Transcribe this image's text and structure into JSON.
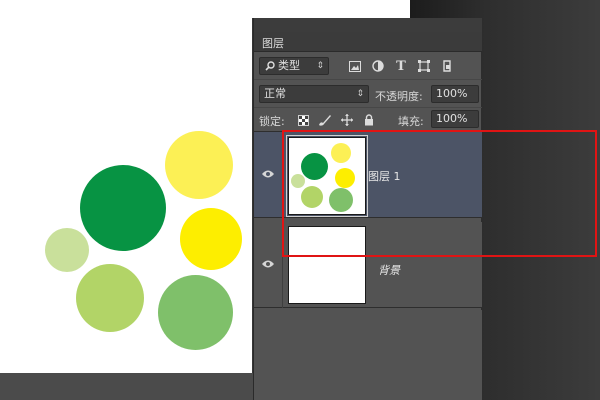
{
  "panel": {
    "tab_label": "图层",
    "filter": {
      "label": "类型",
      "icons": [
        "image-filter-icon",
        "adjustment-filter-icon",
        "type-filter-icon",
        "shape-filter-icon",
        "smart-object-filter-icon"
      ]
    },
    "blend_mode": "正常",
    "opacity_label": "不透明度:",
    "opacity_value": "100%",
    "lock_label": "锁定:",
    "lock_icons": [
      "lock-transparent-icon",
      "lock-brush-icon",
      "lock-move-icon",
      "lock-all-icon"
    ],
    "fill_label": "填充:",
    "fill_value": "100%"
  },
  "layers": [
    {
      "name": "图层 1",
      "selected": true,
      "visible": true
    },
    {
      "name": "背景",
      "selected": false,
      "visible": true
    }
  ],
  "colors": {
    "dark_green": "#079343",
    "light_yellow": "#fcf055",
    "yellow": "#fdee00",
    "pale_green": "#c9e09b",
    "lime_green": "#b2d467",
    "mid_green": "#7fc06a",
    "highlight": "#e01414",
    "selected_row": "#4c5466"
  }
}
